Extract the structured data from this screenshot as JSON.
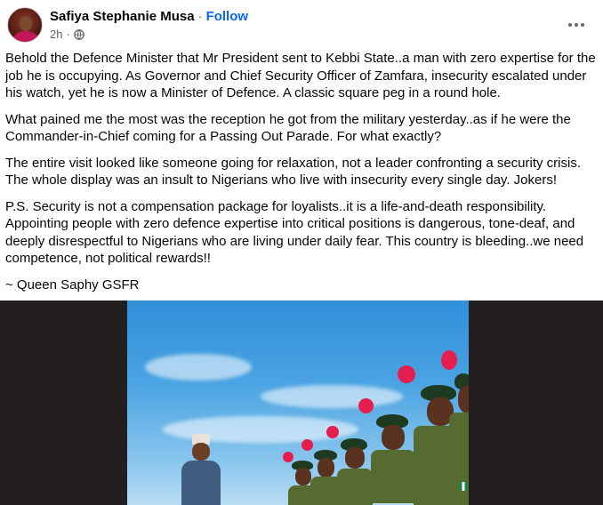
{
  "post": {
    "author": "Safiya Stephanie Musa",
    "separator": "·",
    "follow_label": "Follow",
    "time": "2h",
    "audience_icon": "globe-icon",
    "more_icon": "more-options-icon",
    "paragraphs": [
      "Behold the Defence Minister that Mr President sent to Kebbi State..a man with zero expertise for the job he is occupying. As Governor and Chief Security Officer of Zamfara, insecurity escalated under his watch, yet he is now a Minister of Defence. A classic square peg in a round hole.",
      "What pained me the most was the reception he got from the military yesterday..as if he were the Commander-in-Chief coming for a Passing Out Parade. For what exactly?",
      "The entire visit looked like someone going for relaxation, not a leader confronting a security crisis. The whole display was an insult to Nigerians who live with insecurity every single day. Jokers!",
      "P.S. Security is not a compensation package for loyalists..it is a life-and-death responsibility. Appointing people with zero defence expertise into critical positions is dangerous, tone-deaf, and deeply disrespectful to Nigerians who are living under daily fear. This country is bleeding..we need competence, not political rewards!!",
      "~ Queen Saphy GSFR"
    ]
  },
  "colors": {
    "link": "#0866ff",
    "secondary_text": "#65676b",
    "photo_frame": "#231f20",
    "plume": "#e41e4f",
    "uniform": "#556b2f"
  }
}
